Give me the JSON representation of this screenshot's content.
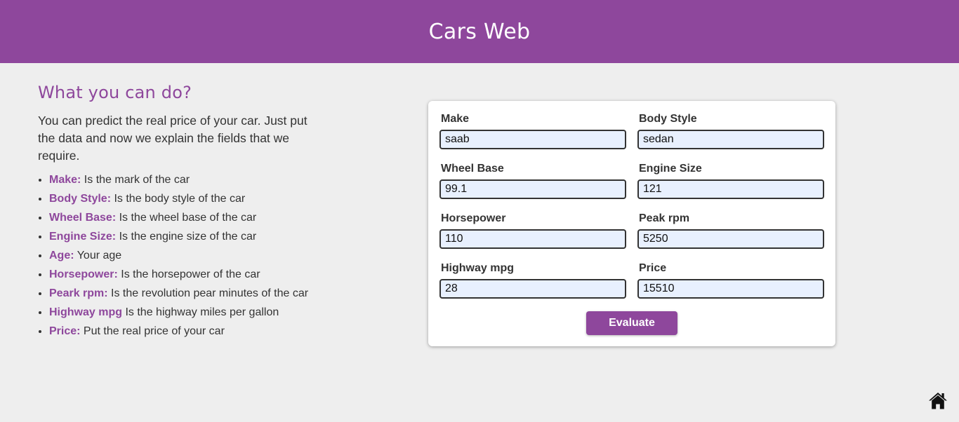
{
  "header": {
    "title": "Cars Web"
  },
  "info": {
    "heading": "What you can do?",
    "intro": "You can predict the real price of your car. Just put the data and now we explain the fields that we require.",
    "items": [
      {
        "term": "Make:",
        "desc": " Is the mark of the car"
      },
      {
        "term": "Body Style:",
        "desc": " Is the body style of the car"
      },
      {
        "term": "Wheel Base:",
        "desc": " Is the wheel base of the car"
      },
      {
        "term": "Engine Size:",
        "desc": " Is the engine size of the car"
      },
      {
        "term": "Age:",
        "desc": " Your age"
      },
      {
        "term": "Horsepower:",
        "desc": " Is the horsepower of the car"
      },
      {
        "term": "Peark rpm:",
        "desc": " Is the revolution pear minutes of the car"
      },
      {
        "term": "Highway mpg",
        "desc": " Is the highway miles per gallon"
      },
      {
        "term": "Price:",
        "desc": " Put the real price of your car"
      }
    ]
  },
  "form": {
    "make": {
      "label": "Make",
      "value": "saab"
    },
    "body_style": {
      "label": "Body Style",
      "value": "sedan"
    },
    "wheel_base": {
      "label": "Wheel Base",
      "value": "99.1"
    },
    "engine_size": {
      "label": "Engine Size",
      "value": "121"
    },
    "horsepower": {
      "label": "Horsepower",
      "value": "110"
    },
    "peak_rpm": {
      "label": "Peak rpm",
      "value": "5250"
    },
    "highway_mpg": {
      "label": "Highway mpg",
      "value": "28"
    },
    "price": {
      "label": "Price",
      "value": "15510"
    },
    "submit_label": "Evaluate"
  },
  "icons": {
    "home": "home-icon"
  },
  "colors": {
    "brand": "#8e479c",
    "background": "#eeeeee",
    "input_bg": "#e8f0fe"
  }
}
